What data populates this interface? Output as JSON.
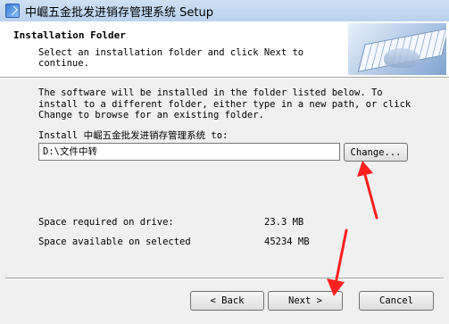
{
  "window": {
    "title": "中崛五金批发进销存管理系统 Setup"
  },
  "header": {
    "title": "Installation Folder",
    "subtitle": "Select an installation folder and click Next to continue."
  },
  "main": {
    "description": "The software will be installed in the folder listed below. To install to a different folder, either type in a new path, or click Change to browse for an existing folder.",
    "install_label": "Install 中崛五金批发进销存管理系统 to:",
    "install_path": "D:\\文件中转",
    "change_button": "Change...",
    "space_required_label": "Space required on drive:",
    "space_required_value": "23.3 MB",
    "space_available_label": "Space available on selected",
    "space_available_value": "45234 MB"
  },
  "footer": {
    "back_button": "< Back",
    "next_button": "Next >",
    "cancel_button": "Cancel"
  },
  "colors": {
    "annotation_arrow": "#ff2020"
  }
}
